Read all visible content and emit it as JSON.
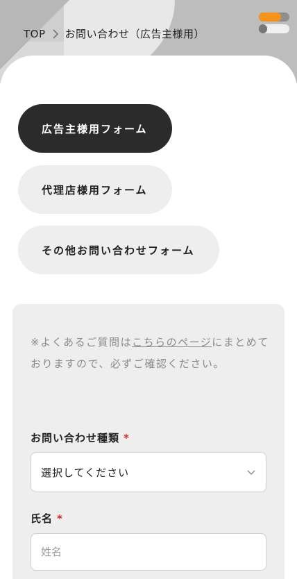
{
  "breadcrumb": {
    "home": "TOP",
    "current": "お問い合わせ（広告主様用）"
  },
  "tabs": [
    {
      "label": "広告主様用フォーム",
      "active": true
    },
    {
      "label": "代理店様用フォーム",
      "active": false
    },
    {
      "label": "その他お問い合わせフォーム",
      "active": false
    }
  ],
  "notice": {
    "prefix": "※よくあるご質問は",
    "link": "こちらのページ",
    "suffix": "にまとめておりますので、必ずご確認ください。"
  },
  "form": {
    "inquiry_type": {
      "label": "お問い合わせ種類",
      "required_mark": "*",
      "value": "選択してください"
    },
    "name": {
      "label": "氏名",
      "required_mark": "*",
      "placeholder": "姓名"
    }
  },
  "colors": {
    "accent": "#f4941d",
    "active_tab": "#2b2b2b",
    "required": "#d9252a"
  },
  "icons": {
    "breadcrumb_separator": "chevron-right-icon",
    "select": "chevron-down-icon",
    "menu": "menu-toggle-icon"
  }
}
